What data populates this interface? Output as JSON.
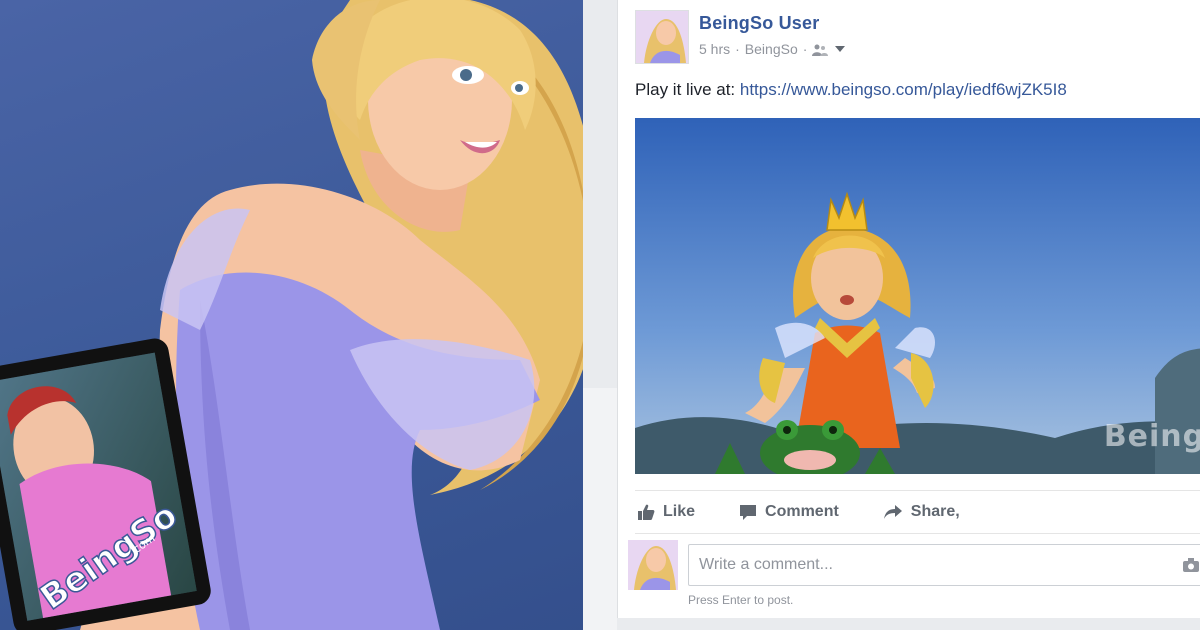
{
  "post": {
    "author": "BeingSo User",
    "time": "5 hrs",
    "separator": "·",
    "source": "BeingSo",
    "text_prefix": "Play it live at: ",
    "link": "https://www.beingso.com/play/iedf6wjZK5I8",
    "video_watermark": "Beings"
  },
  "actions": {
    "like": "Like",
    "comment": "Comment",
    "share": "Share,"
  },
  "comment": {
    "placeholder": "Write a comment...",
    "hint": "Press Enter to post."
  },
  "promo": {
    "tablet_logo": "BeingSo",
    "tablet_logo_suffix": ".com"
  },
  "colors": {
    "brand_blue": "#3b5998",
    "link": "#365899",
    "muted": "#90949c",
    "dress": "#9b95e8"
  },
  "icons": [
    "audience-icon",
    "caret-down-icon",
    "like-icon",
    "comment-icon",
    "share-icon",
    "camera-icon",
    "crown-icon"
  ]
}
